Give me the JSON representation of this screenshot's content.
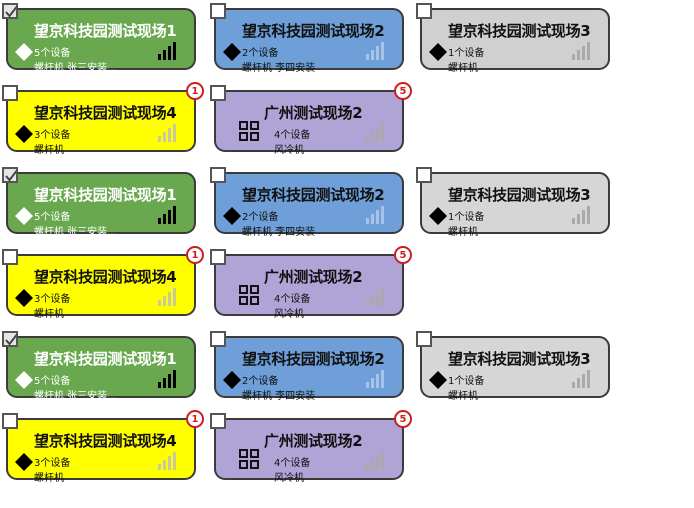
{
  "colors": {
    "green": "#69a84f",
    "blue": "#6e9fd8",
    "gray": "#d0d0d0",
    "yellow": "#ffff00",
    "purple": "#b0a4d7",
    "badge_red": "#cc1e1e"
  },
  "icons": {
    "checkbox_checked": "checkbox-checked-icon",
    "checkbox": "checkbox-icon",
    "diamond": "diamond-icon",
    "grid": "grid-icon",
    "signal": "signal-bars-icon"
  },
  "groups": [
    {
      "cards": [
        {
          "title": "望京科技园测试现场1",
          "count": "5个设备",
          "desc": "螺杆机 张三安装...",
          "color": "green",
          "icon": "diamond-white",
          "checked": true,
          "badge": "",
          "signal": "strong"
        },
        {
          "title": "望京科技园测试现场2",
          "count": "2个设备",
          "desc": "螺杆机 李四安装",
          "color": "blue",
          "icon": "diamond-black",
          "checked": false,
          "badge": "",
          "signal": "weak"
        },
        {
          "title": "望京科技园测试现场3",
          "count": "1个设备",
          "desc": "螺杆机",
          "color": "gray",
          "icon": "diamond-black",
          "checked": false,
          "badge": "",
          "signal": "weak"
        },
        {
          "title": "望京科技园测试现场4",
          "count": "3个设备",
          "desc": "螺杆机",
          "color": "yellow",
          "icon": "diamond-black",
          "checked": false,
          "badge": "1",
          "signal": "weak"
        },
        {
          "title": "广州测试现场2",
          "count": "4个设备",
          "desc": "风冷机",
          "color": "purple",
          "icon": "grid",
          "checked": false,
          "badge": "5",
          "signal": "weak"
        }
      ]
    },
    {
      "cards": [
        {
          "title": "望京科技园测试现场1",
          "count": "5个设备",
          "desc": "螺杆机 张三安装...",
          "color": "green",
          "icon": "diamond-white",
          "checked": true,
          "badge": "",
          "signal": "strong"
        },
        {
          "title": "望京科技园测试现场2",
          "count": "2个设备",
          "desc": "螺杆机 李四安装",
          "color": "blue",
          "icon": "diamond-black",
          "checked": false,
          "badge": "",
          "signal": "weak"
        },
        {
          "title": "望京科技园测试现场3",
          "count": "1个设备",
          "desc": "螺杆机",
          "color": "gray-white",
          "icon": "diamond-black",
          "checked": false,
          "badge": "",
          "signal": "weak"
        },
        {
          "title": "望京科技园测试现场4",
          "count": "3个设备",
          "desc": "螺杆机",
          "color": "yellow",
          "icon": "diamond-black",
          "checked": false,
          "badge": "1",
          "signal": "weak"
        },
        {
          "title": "广州测试现场2",
          "count": "4个设备",
          "desc": "风冷机",
          "color": "purple",
          "icon": "grid",
          "checked": false,
          "badge": "5",
          "signal": "weak"
        }
      ]
    },
    {
      "cards": [
        {
          "title": "望京科技园测试现场1",
          "count": "5个设备",
          "desc": "螺杆机 张三安装...",
          "color": "green",
          "icon": "diamond-white",
          "checked": true,
          "badge": "",
          "signal": "strong"
        },
        {
          "title": "望京科技园测试现场2",
          "count": "2个设备",
          "desc": "螺杆机 李四安装",
          "color": "blue",
          "icon": "diamond-black",
          "checked": false,
          "badge": "",
          "signal": "weak"
        },
        {
          "title": "望京科技园测试现场3",
          "count": "1个设备",
          "desc": "螺杆机",
          "color": "gray-white",
          "icon": "diamond-black",
          "checked": false,
          "badge": "",
          "signal": "weak"
        },
        {
          "title": "望京科技园测试现场4",
          "count": "3个设备",
          "desc": "螺杆机",
          "color": "yellow",
          "icon": "diamond-black",
          "checked": false,
          "badge": "1",
          "signal": "weak"
        },
        {
          "title": "广州测试现场2",
          "count": "4个设备",
          "desc": "风冷机",
          "color": "purple",
          "icon": "grid",
          "checked": false,
          "badge": "5",
          "signal": "weak"
        }
      ]
    }
  ]
}
